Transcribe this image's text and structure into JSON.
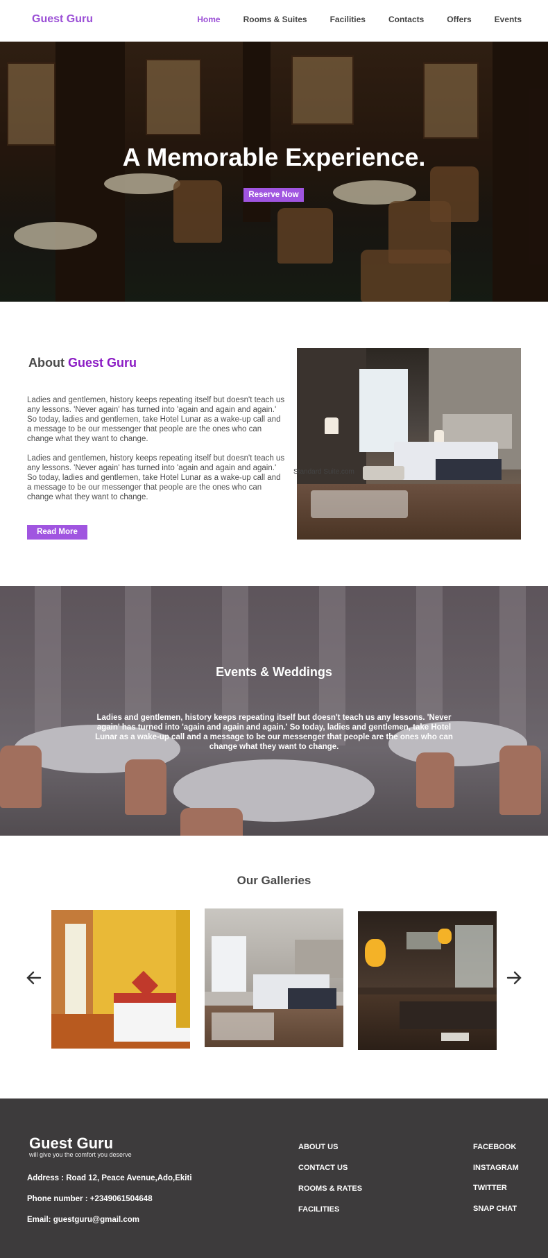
{
  "nav": {
    "brand": "Guest Guru",
    "links": [
      {
        "label": "Home",
        "active": true
      },
      {
        "label": "Rooms & Suites"
      },
      {
        "label": "Facilities"
      },
      {
        "label": "Contacts"
      },
      {
        "label": "Offers"
      },
      {
        "label": "Events"
      }
    ]
  },
  "hero": {
    "title": "A Memorable Experience.",
    "button": "Reserve Now"
  },
  "about": {
    "title_prefix": "About",
    "title_accent": "Guest Guru",
    "paragraphs": [
      "Ladies and gentlemen, history keeps repeating itself but doesn't teach us any lessons. 'Never again' has turned into 'again and again and again.' So today, ladies and gentlemen, take Hotel Lunar as a wake-up call and a message to be our messenger that people are the ones who can change what they want to change.",
      "Ladies and gentlemen, history keeps repeating itself but doesn't teach us any lessons. 'Never again' has turned into 'again and again and again.' So today, ladies and gentlemen, take Hotel Lunar as a wake-up call and a message to be our messenger that people are the ones who can change what they want to change."
    ],
    "button": "Read More",
    "image_caption": "Standard Suite.com"
  },
  "events": {
    "title": "Events & Weddings",
    "text": "Ladies and gentlemen, history keeps repeating itself but doesn't teach us any lessons. 'Never again' has turned into 'again and again and again.' So today, ladies and gentlemen, take Hotel Lunar as a wake-up call and a message to be our messenger that people are the ones who can change what they want to change."
  },
  "gallery": {
    "title": "Our Galleries",
    "prev_icon": "arrow-left-icon",
    "next_icon": "arrow-right-icon"
  },
  "footer": {
    "brand": "Guest Guru",
    "tagline": "will give you the comfort you deserve",
    "address": "Address : Road 12, Peace Avenue,Ado,Ekiti",
    "phone": "Phone number : +2349061504648",
    "email": "Email: guestguru@gmail.com",
    "links": [
      "ABOUT US",
      "CONTACT US",
      "ROOMS & RATES",
      "FACILITIES"
    ],
    "social": [
      "FACEBOOK",
      "INSTAGRAM",
      "TWITTER",
      "SNAP CHAT"
    ]
  },
  "colors": {
    "accent": "#9b4fd6",
    "accent_dark": "#8b1cc4",
    "footer_bg": "#3d3b3c"
  }
}
